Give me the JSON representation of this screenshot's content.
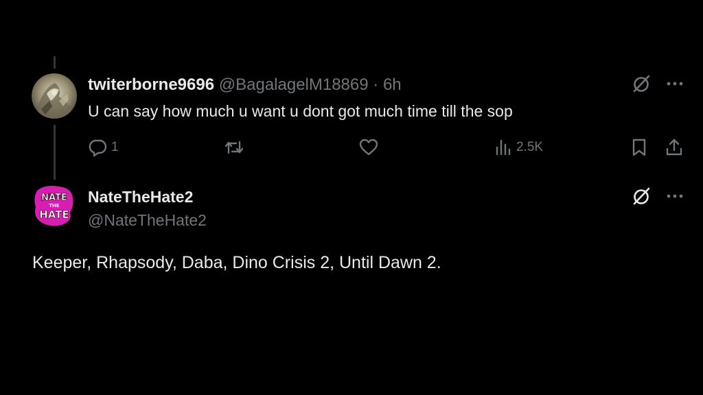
{
  "reply": {
    "display_name": "twiterborne9696",
    "handle": "@BagalagelM18869",
    "separator": " · ",
    "time": "6h",
    "text": "U can say how much u want u dont got much time till the sop",
    "reply_count": "1",
    "view_count": "2.5K"
  },
  "main_post": {
    "display_name": "NateTheHate2",
    "handle": "@NateTheHate2",
    "text": "Keeper, Rhapsody, Daba, Dino Crisis 2, Until Dawn 2.",
    "avatar_text_top": "NATE",
    "avatar_text_mid": "THE",
    "avatar_text_bottom": "HATE"
  },
  "icons": {
    "grok": "grok-icon",
    "more": "more-icon",
    "reply": "reply-icon",
    "retweet": "retweet-icon",
    "like": "like-icon",
    "views": "views-icon",
    "bookmark": "bookmark-icon",
    "share": "share-icon"
  },
  "colors": {
    "background": "#000000",
    "primary_text": "#e7e9ea",
    "secondary_text": "#71767b",
    "thread_line": "#333639",
    "avatar_accent": "#d61fb0"
  }
}
